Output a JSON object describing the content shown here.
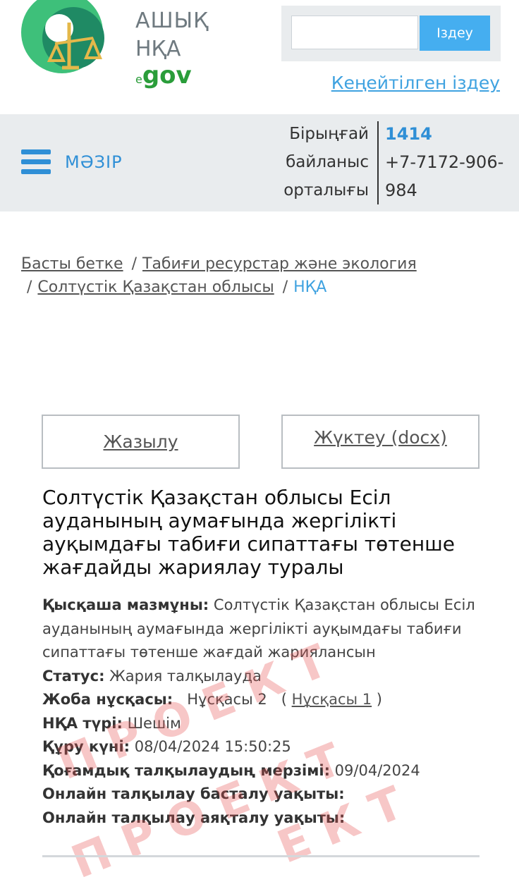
{
  "header": {
    "logo_line1": "АШЫҚ",
    "logo_line2": "НҚА",
    "logo_gov": "gov",
    "search_button": "Іздеу",
    "advanced_search": "Кеңейтілген іздеу"
  },
  "nav": {
    "menu_label": "МӘЗІР",
    "contact_label_lines": [
      "Бірыңғай",
      "байланыс",
      "орталығы"
    ],
    "hotline": "1414",
    "phone": "+7-7172-906-984"
  },
  "breadcrumb": {
    "items": [
      "Басты бетке",
      "Табиғи ресурстар және экология",
      "Солтүстік Қазақстан облысы"
    ],
    "current": "НҚА",
    "separator": "/"
  },
  "actions": {
    "subscribe": "Жазылу",
    "download": "Жүктеу (docx)"
  },
  "document": {
    "title": "Солтүстік Қазақстан облысы Есіл ауданының аумағында жергілікті ауқымдағы табиғи сипаттағы төтенше жағдайды жариялау туралы",
    "summary_label": "Қысқаша мазмұны:",
    "summary": "Солтүстік Қазақстан облысы Есіл ауданының аумағында жергілікті ауқымдағы табиғи сипаттағы төтенше жағдай жариялансын",
    "status_label": "Статус:",
    "status": "Жария талқылауда",
    "version_label": "Жоба нұсқасы:",
    "version": "Нұсқасы 2",
    "prev_version_open": "(",
    "prev_version": "Нұсқасы 1",
    "prev_version_close": ")",
    "type_label": "НҚА түрі:",
    "type": "Шешім",
    "created_label": "Құру күні:",
    "created": "08/04/2024 15:50:25",
    "public_discussion_label": "Қоғамдық талқылаудың мерзімі:",
    "public_discussion": "09/04/2024",
    "online_start_label": "Онлайн талқылау басталу уақыты:",
    "online_end_label": "Онлайн талқылау аяқталу уақыты:"
  },
  "watermark": {
    "text1": "ПРОЕКТ",
    "text2": "ПРОЕКТ",
    "text3": "ЕКТ"
  },
  "colors": {
    "accent": "#3fa2e0",
    "search_button": "#45aef0",
    "nav_bg": "#e9ecee",
    "logo_green": "#2a9d3a",
    "watermark": "#e65050"
  }
}
